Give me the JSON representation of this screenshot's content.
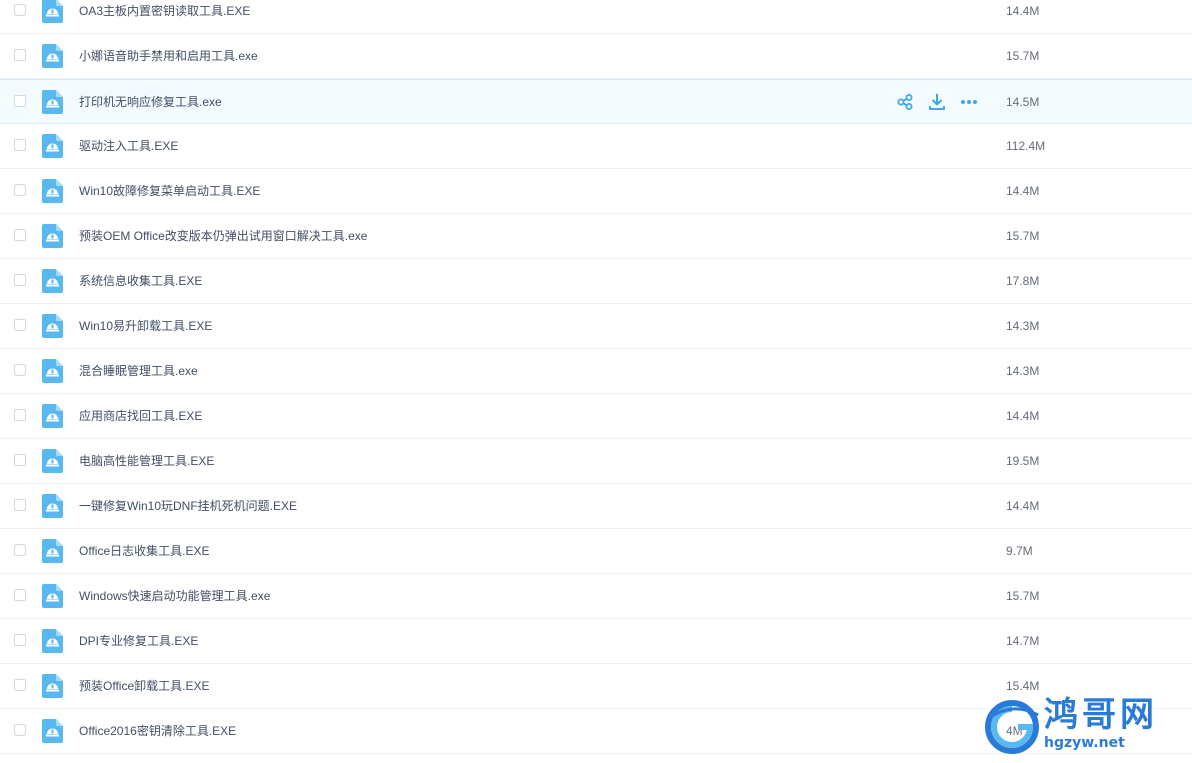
{
  "files": [
    {
      "name": "OA3主板内置密钥读取工具.EXE",
      "size": "14.4M"
    },
    {
      "name": "小娜语音助手禁用和启用工具.exe",
      "size": "15.7M"
    },
    {
      "name": "打印机无响应修复工具.exe",
      "size": "14.5M"
    },
    {
      "name": "驱动注入工具.EXE",
      "size": "112.4M"
    },
    {
      "name": "Win10故障修复菜单启动工具.EXE",
      "size": "14.4M"
    },
    {
      "name": "预装OEM Office改变版本仍弹出试用窗口解决工具.exe",
      "size": "15.7M"
    },
    {
      "name": "系统信息收集工具.EXE",
      "size": "17.8M"
    },
    {
      "name": "Win10易升卸载工具.EXE",
      "size": "14.3M"
    },
    {
      "name": "混合睡眠管理工具.exe",
      "size": "14.3M"
    },
    {
      "name": "应用商店找回工具.EXE",
      "size": "14.4M"
    },
    {
      "name": "电脑高性能管理工具.EXE",
      "size": "19.5M"
    },
    {
      "name": "一键修复Win10玩DNF挂机死机问题.EXE",
      "size": "14.4M"
    },
    {
      "name": "Office日志收集工具.EXE",
      "size": "9.7M"
    },
    {
      "name": "Windows快速启动功能管理工具.exe",
      "size": "15.7M"
    },
    {
      "name": "DPI专业修复工具.EXE",
      "size": "14.7M"
    },
    {
      "name": "预装Office卸载工具.EXE",
      "size": "15.4M"
    },
    {
      "name": "Office2016密钥清除工具.EXE",
      "size": "4M"
    }
  ],
  "hovered_index": 2,
  "row_actions": [
    {
      "name": "share",
      "icon": "share-icon"
    },
    {
      "name": "download",
      "icon": "download-icon"
    },
    {
      "name": "more",
      "icon": "more-icon"
    }
  ],
  "watermark": {
    "title": "鸿哥网",
    "url": "hgzyw.net"
  },
  "colors": {
    "accent": "#3fa9e8",
    "file_icon": "#5ab8f0",
    "hover_bg": "#f4fbff",
    "watermark": "#2a7bd8"
  }
}
